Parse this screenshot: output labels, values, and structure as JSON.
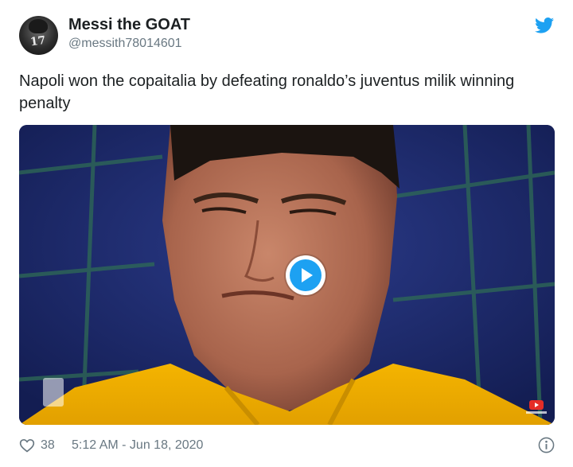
{
  "user": {
    "display_name": "Messi the GOAT",
    "handle": "@messith78014601",
    "avatar_icon": "player-portrait-avatar"
  },
  "tweet": {
    "text": "Napoli won the copaitalia by defeating ronaldo’s juventus milik winning penalty"
  },
  "media": {
    "type": "video",
    "play_icon": "play-icon",
    "watermarks": [
      "competition-cup-logo",
      "youtube-logo"
    ]
  },
  "footer": {
    "likes": "38",
    "timestamp": "5:12 AM - Jun 18, 2020",
    "like_icon": "heart-icon",
    "info_icon": "info-icon"
  },
  "brand": {
    "twitter_icon": "twitter-bird-icon",
    "accent_color": "#1da1f2"
  }
}
